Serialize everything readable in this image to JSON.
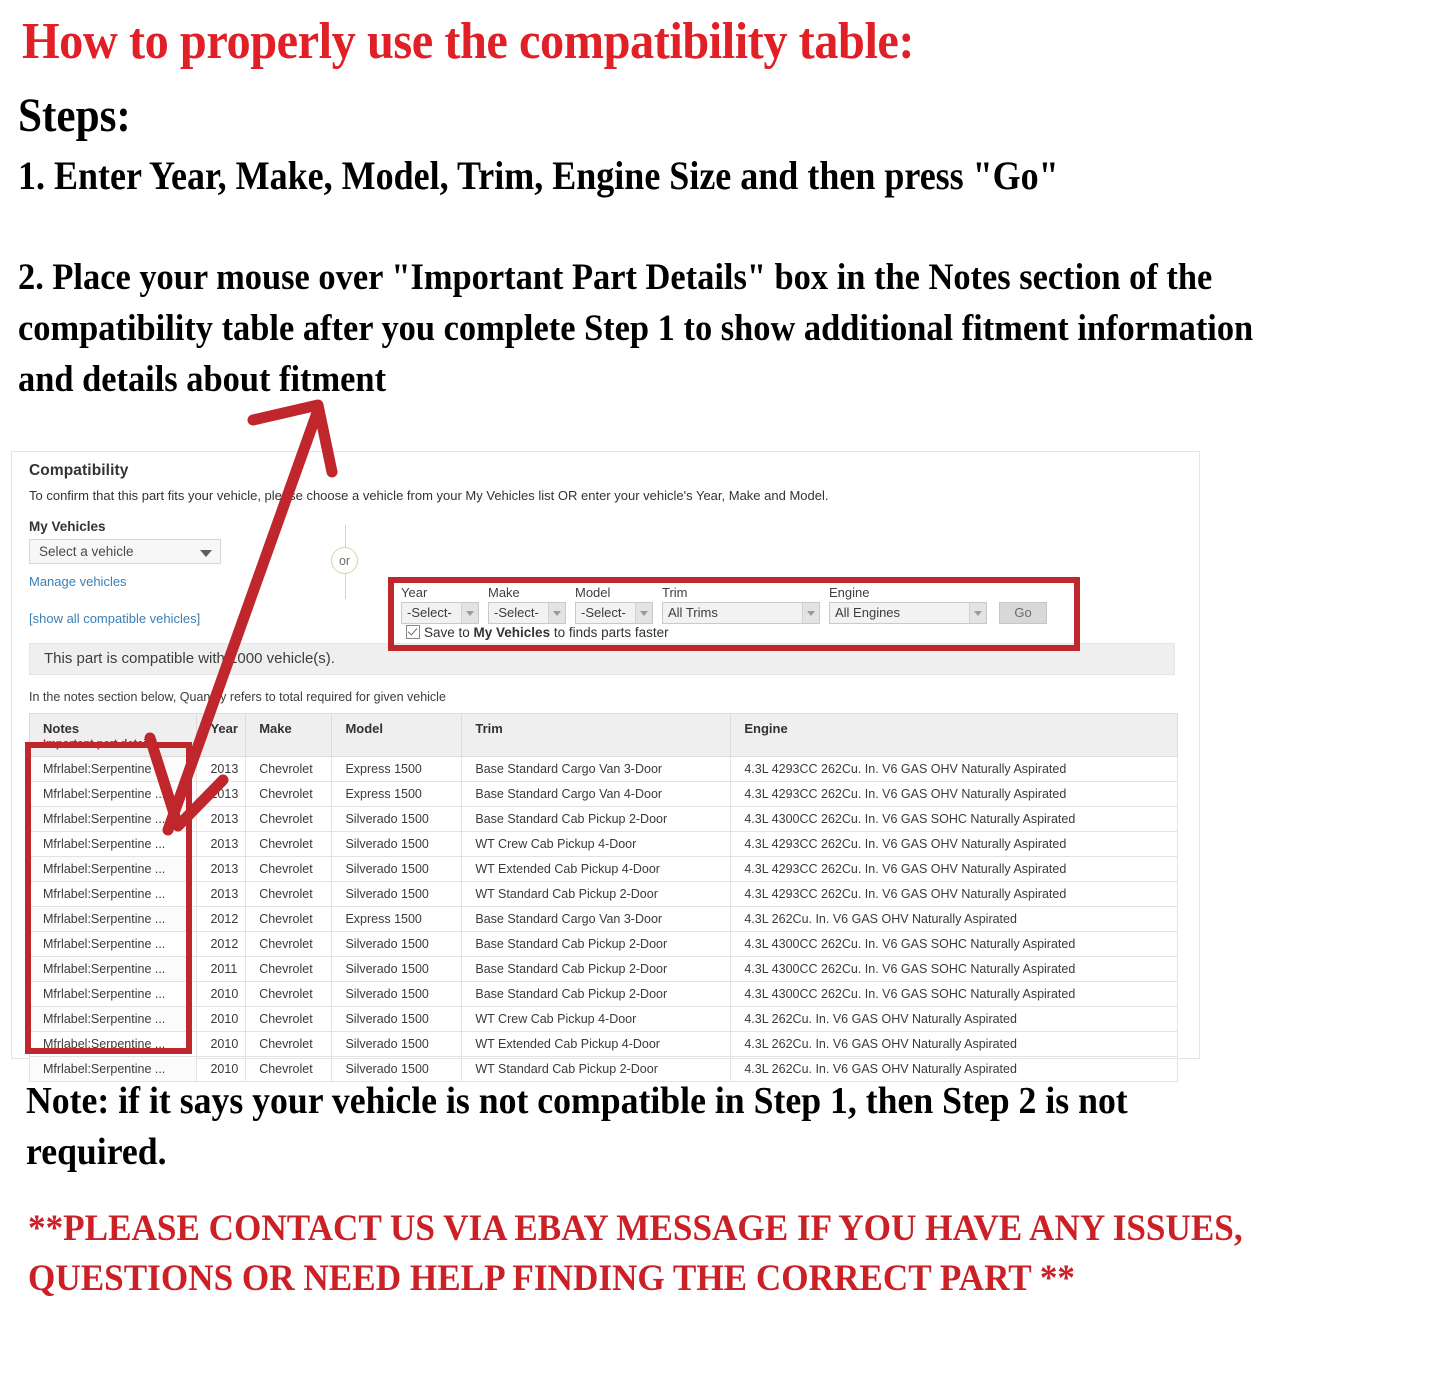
{
  "instructions": {
    "title": "How to properly use the compatibility table:",
    "steps_label": "Steps:",
    "step1": "1. Enter Year, Make, Model, Trim, Engine Size and then press \"Go\"",
    "step2": "2. Place your mouse over \"Important Part Details\" box in the Notes section of the compatibility table after you complete Step 1 to show additional fitment information and details about fitment",
    "bottom_note": "Note: if it says your vehicle is not compatible in Step 1, then Step 2 is not required.",
    "contact_notice": "**PLEASE CONTACT US VIA EBAY MESSAGE IF YOU HAVE ANY ISSUES, QUESTIONS OR NEED HELP FINDING THE CORRECT PART **"
  },
  "colors": {
    "heading_red": "#e01f26",
    "annotation_red": "#c0272d",
    "contact_red": "#cb2026",
    "link_blue": "#3a7fb5"
  },
  "compatibility": {
    "heading": "Compatibility",
    "subheading": "To confirm that this part fits your vehicle, please choose a vehicle from your My Vehicles list OR enter your vehicle's Year, Make and Model.",
    "my_vehicles": {
      "label": "My Vehicles",
      "select_value": "Select a vehicle",
      "manage_link": "Manage vehicles",
      "show_all_link": "[show all compatible vehicles]"
    },
    "divider_text": "or",
    "form": {
      "fields": [
        {
          "label": "Year",
          "value": "-Select-"
        },
        {
          "label": "Make",
          "value": "-Select-"
        },
        {
          "label": "Model",
          "value": "-Select-"
        },
        {
          "label": "Trim",
          "value": "All Trims"
        },
        {
          "label": "Engine",
          "value": "All Engines"
        }
      ],
      "go_button": "Go",
      "save_checkbox": {
        "checked": true,
        "prefix": "Save to ",
        "bold": "My Vehicles",
        "suffix": " to finds parts faster"
      }
    },
    "count_banner": "This part is compatible with 1000 vehicle(s).",
    "notes_hint": "In the notes section below, Quantity refers to total required for given vehicle",
    "table": {
      "headers": [
        "Notes",
        "Year",
        "Make",
        "Model",
        "Trim",
        "Engine"
      ],
      "notes_subheader": "Important part details",
      "rows": [
        {
          "notes": "Mfrlabel:Serpentine ...",
          "year": "2013",
          "make": "Chevrolet",
          "model": "Express 1500",
          "trim": "Base Standard Cargo Van 3-Door",
          "engine": "4.3L 4293CC 262Cu. In. V6 GAS OHV Naturally Aspirated"
        },
        {
          "notes": "Mfrlabel:Serpentine ...",
          "year": "2013",
          "make": "Chevrolet",
          "model": "Express 1500",
          "trim": "Base Standard Cargo Van 4-Door",
          "engine": "4.3L 4293CC 262Cu. In. V6 GAS OHV Naturally Aspirated"
        },
        {
          "notes": "Mfrlabel:Serpentine ...",
          "year": "2013",
          "make": "Chevrolet",
          "model": "Silverado 1500",
          "trim": "Base Standard Cab Pickup 2-Door",
          "engine": "4.3L 4300CC 262Cu. In. V6 GAS SOHC Naturally Aspirated"
        },
        {
          "notes": "Mfrlabel:Serpentine ...",
          "year": "2013",
          "make": "Chevrolet",
          "model": "Silverado 1500",
          "trim": "WT Crew Cab Pickup 4-Door",
          "engine": "4.3L 4293CC 262Cu. In. V6 GAS OHV Naturally Aspirated"
        },
        {
          "notes": "Mfrlabel:Serpentine ...",
          "year": "2013",
          "make": "Chevrolet",
          "model": "Silverado 1500",
          "trim": "WT Extended Cab Pickup 4-Door",
          "engine": "4.3L 4293CC 262Cu. In. V6 GAS OHV Naturally Aspirated"
        },
        {
          "notes": "Mfrlabel:Serpentine ...",
          "year": "2013",
          "make": "Chevrolet",
          "model": "Silverado 1500",
          "trim": "WT Standard Cab Pickup 2-Door",
          "engine": "4.3L 4293CC 262Cu. In. V6 GAS OHV Naturally Aspirated"
        },
        {
          "notes": "Mfrlabel:Serpentine ...",
          "year": "2012",
          "make": "Chevrolet",
          "model": "Express 1500",
          "trim": "Base Standard Cargo Van 3-Door",
          "engine": "4.3L 262Cu. In. V6 GAS OHV Naturally Aspirated"
        },
        {
          "notes": "Mfrlabel:Serpentine ...",
          "year": "2012",
          "make": "Chevrolet",
          "model": "Silverado 1500",
          "trim": "Base Standard Cab Pickup 2-Door",
          "engine": "4.3L 4300CC 262Cu. In. V6 GAS SOHC Naturally Aspirated"
        },
        {
          "notes": "Mfrlabel:Serpentine ...",
          "year": "2011",
          "make": "Chevrolet",
          "model": "Silverado 1500",
          "trim": "Base Standard Cab Pickup 2-Door",
          "engine": "4.3L 4300CC 262Cu. In. V6 GAS SOHC Naturally Aspirated"
        },
        {
          "notes": "Mfrlabel:Serpentine ...",
          "year": "2010",
          "make": "Chevrolet",
          "model": "Silverado 1500",
          "trim": "Base Standard Cab Pickup 2-Door",
          "engine": "4.3L 4300CC 262Cu. In. V6 GAS SOHC Naturally Aspirated"
        },
        {
          "notes": "Mfrlabel:Serpentine ...",
          "year": "2010",
          "make": "Chevrolet",
          "model": "Silverado 1500",
          "trim": "WT Crew Cab Pickup 4-Door",
          "engine": "4.3L 262Cu. In. V6 GAS OHV Naturally Aspirated"
        },
        {
          "notes": "Mfrlabel:Serpentine ...",
          "year": "2010",
          "make": "Chevrolet",
          "model": "Silverado 1500",
          "trim": "WT Extended Cab Pickup 4-Door",
          "engine": "4.3L 262Cu. In. V6 GAS OHV Naturally Aspirated"
        },
        {
          "notes": "Mfrlabel:Serpentine ...",
          "year": "2010",
          "make": "Chevrolet",
          "model": "Silverado 1500",
          "trim": "WT Standard Cab Pickup 2-Door",
          "engine": "4.3L 262Cu. In. V6 GAS OHV Naturally Aspirated"
        }
      ]
    }
  }
}
